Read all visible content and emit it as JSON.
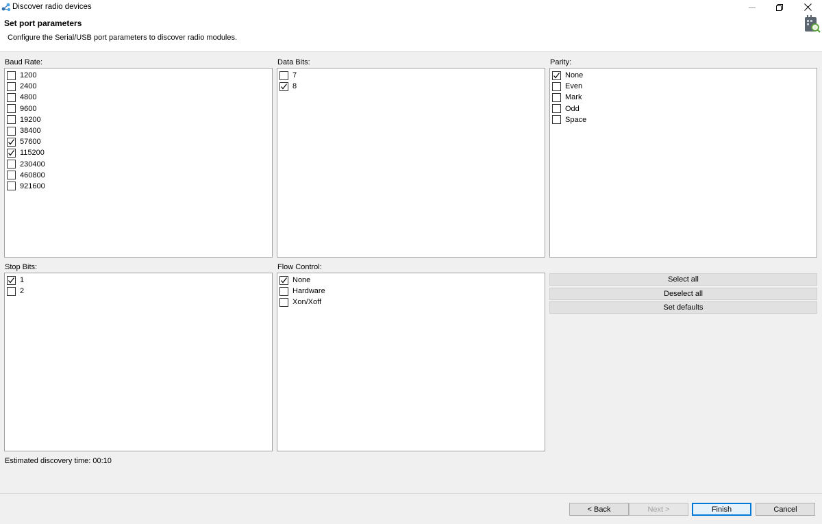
{
  "window": {
    "title": "Discover radio devices"
  },
  "header": {
    "title": "Set port parameters",
    "description": "Configure the Serial/USB port parameters to discover radio modules."
  },
  "baud": {
    "label": "Baud Rate:",
    "items": [
      {
        "label": "1200",
        "checked": false
      },
      {
        "label": "2400",
        "checked": false
      },
      {
        "label": "4800",
        "checked": false
      },
      {
        "label": "9600",
        "checked": false
      },
      {
        "label": "19200",
        "checked": false
      },
      {
        "label": "38400",
        "checked": false
      },
      {
        "label": "57600",
        "checked": true
      },
      {
        "label": "115200",
        "checked": true
      },
      {
        "label": "230400",
        "checked": false
      },
      {
        "label": "460800",
        "checked": false
      },
      {
        "label": "921600",
        "checked": false
      }
    ]
  },
  "databits": {
    "label": "Data Bits:",
    "items": [
      {
        "label": "7",
        "checked": false
      },
      {
        "label": "8",
        "checked": true
      }
    ]
  },
  "parity": {
    "label": "Parity:",
    "items": [
      {
        "label": "None",
        "checked": true
      },
      {
        "label": "Even",
        "checked": false
      },
      {
        "label": "Mark",
        "checked": false
      },
      {
        "label": "Odd",
        "checked": false
      },
      {
        "label": "Space",
        "checked": false
      }
    ]
  },
  "stopbits": {
    "label": "Stop Bits:",
    "items": [
      {
        "label": "1",
        "checked": true
      },
      {
        "label": "2",
        "checked": false
      }
    ]
  },
  "flow": {
    "label": "Flow Control:",
    "items": [
      {
        "label": "None",
        "checked": true
      },
      {
        "label": "Hardware",
        "checked": false
      },
      {
        "label": "Xon/Xoff",
        "checked": false
      }
    ]
  },
  "actions": {
    "select_all": "Select all",
    "deselect_all": "Deselect all",
    "set_defaults": "Set defaults"
  },
  "estimate": "Estimated discovery time: 00:10",
  "footer": {
    "back": "< Back",
    "next": "Next >",
    "finish": "Finish",
    "cancel": "Cancel"
  },
  "colors": {
    "background": "#f0f0f0",
    "listbox_border": "#a0a0a0",
    "primary_border": "#0078d7",
    "disabled_text": "#a0a0a0"
  }
}
